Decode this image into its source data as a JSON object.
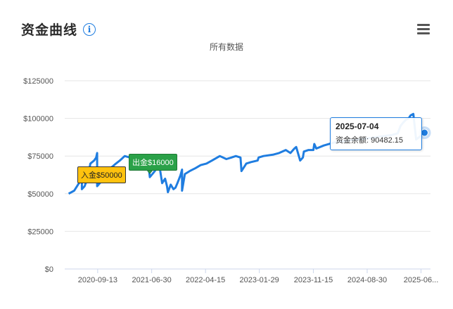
{
  "header": {
    "title": "资金曲线",
    "info_icon": "info-icon",
    "menu_icon": "hamburger-menu-icon"
  },
  "subtitle": "所有数据",
  "colors": {
    "line": "#1f7de0",
    "deposit_flag": "#ffc20e",
    "withdraw_flag": "#2aa148",
    "grid": "#e6e6e6"
  },
  "flags": {
    "deposit": {
      "label": "入金$50000",
      "date": "2020-06-15"
    },
    "withdraw": {
      "label": "出金$16000",
      "date": "2021-06-20"
    }
  },
  "tooltip": {
    "date": "2025-07-04",
    "label": "资金余额:",
    "value": "90482.15"
  },
  "chart_data": {
    "type": "line",
    "title": "资金曲线",
    "subtitle": "所有数据",
    "xlabel": "",
    "ylabel": "",
    "ylim": [
      0,
      125000
    ],
    "yticks": [
      0,
      25000,
      50000,
      75000,
      100000,
      125000
    ],
    "ytick_labels": [
      "$0",
      "$25000",
      "$50000",
      "$75000",
      "$100000",
      "$125000"
    ],
    "xlim": [
      "2020-03-20",
      "2025-08-05"
    ],
    "xticks": [
      "2020-09-13",
      "2021-06-30",
      "2022-04-15",
      "2023-01-29",
      "2023-11-15",
      "2024-08-30",
      "2025-06-15"
    ],
    "xtick_labels": [
      "2020-09-13",
      "2021-06-30",
      "2022-04-15",
      "2023-01-29",
      "2023-11-15",
      "2024-08-30",
      "2025-06..."
    ],
    "grid": true,
    "legend": "none",
    "series": [
      {
        "dates": [
          "2020-04-10",
          "2020-05-10",
          "2020-06-10",
          "2020-06-20",
          "2020-06-20",
          "2020-07-05",
          "2020-07-20",
          "2020-08-05",
          "2020-08-25",
          "2020-09-05",
          "2020-09-10",
          "2020-09-10",
          "2020-09-25",
          "2020-10-15",
          "2020-11-10",
          "2020-12-01",
          "2020-12-20",
          "2021-01-10",
          "2021-02-05",
          "2021-03-05",
          "2021-04-10",
          "2021-05-05",
          "2021-05-25",
          "2021-06-10",
          "2021-06-20",
          "2021-07-10",
          "2021-08-10",
          "2021-08-25",
          "2021-09-10",
          "2021-09-20",
          "2021-09-25",
          "2021-10-10",
          "2021-10-25",
          "2021-11-05",
          "2021-11-15",
          "2021-12-01",
          "2021-12-10",
          "2021-12-10",
          "2021-12-25",
          "2022-01-20",
          "2022-02-20",
          "2022-03-20",
          "2022-04-20",
          "2022-05-20",
          "2022-07-01",
          "2022-08-05",
          "2022-09-01",
          "2022-09-25",
          "2022-10-20",
          "2022-10-25",
          "2022-11-15",
          "2022-11-20",
          "2022-12-15",
          "2023-01-20",
          "2023-01-25",
          "2023-02-20",
          "2023-04-15",
          "2023-05-15",
          "2023-06-20",
          "2023-07-15",
          "2023-08-05",
          "2023-08-15",
          "2023-09-05",
          "2023-09-20",
          "2023-09-25",
          "2023-10-20",
          "2023-11-15",
          "2023-11-20",
          "2023-12-01",
          "2024-01-10",
          "2024-03-05",
          "2024-05-05",
          "2024-07-10",
          "2024-09-15",
          "2024-11-10",
          "2025-01-10",
          "2025-02-10",
          "2025-02-25",
          "2025-03-10",
          "2025-03-25",
          "2025-04-10",
          "2025-04-20",
          "2025-05-05",
          "2025-05-20",
          "2025-06-10",
          "2025-07-04"
        ],
        "values": [
          50000,
          52000,
          58000,
          64000,
          53000,
          55000,
          60000,
          70000,
          72000,
          74000,
          77000,
          55000,
          57000,
          62000,
          66000,
          68000,
          70000,
          72000,
          75000,
          74000,
          73000,
          72000,
          73000,
          72000,
          61000,
          64000,
          69000,
          57000,
          60000,
          55000,
          51000,
          56000,
          53000,
          54000,
          57000,
          62000,
          66000,
          52000,
          63000,
          65000,
          67000,
          69000,
          70000,
          72000,
          75000,
          73000,
          74000,
          75000,
          74000,
          65000,
          69000,
          70000,
          71000,
          72000,
          74000,
          75000,
          76000,
          77000,
          79000,
          77000,
          80000,
          81000,
          72000,
          74000,
          78000,
          79000,
          79000,
          83000,
          80000,
          82000,
          84000,
          85000,
          86000,
          87000,
          88000,
          89000,
          90000,
          95000,
          97000,
          99000,
          100000,
          102000,
          103000,
          86000,
          88000,
          90482.15
        ]
      }
    ],
    "annotations": [
      {
        "date": "2020-06-15",
        "text": "入金$50000"
      },
      {
        "date": "2021-06-20",
        "text": "出金$16000"
      },
      {
        "date": "2025-07-04",
        "text": "资金余额:90482.15"
      }
    ]
  }
}
